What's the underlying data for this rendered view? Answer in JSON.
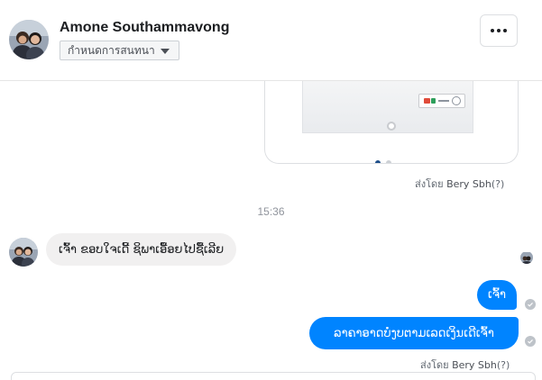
{
  "header": {
    "contact_name": "Amone Southammavong",
    "conversation_settings_label": "กำหนดการสนทนา",
    "more_icon": "more-horizontal-icon"
  },
  "card": {
    "image_desc_icon": "product-image",
    "carousel_pages": 2,
    "carousel_active": 1
  },
  "messages": [
    {
      "sent_by_prefix": "ส่งโดย",
      "sent_by_name": "Bery Sbh",
      "sent_by_suffix": "(?)"
    }
  ],
  "timestamp": "15:36",
  "incoming": {
    "text": "ເຈົ້າ ຂອບໃຈເດີ້ ຊິພາເອື້ອຍໄປຊື້ເລີຍ"
  },
  "outgoing": [
    {
      "text": "ເຈົ້າ"
    },
    {
      "text": "ລາຄາອາດບໍ່ງບຕາມເລດເງິນເດີເຈົ້າ"
    }
  ],
  "footer_sent_by": {
    "prefix": "ส่งโดย",
    "name": "Bery Sbh",
    "suffix": "(?)"
  },
  "colors": {
    "accent": "#0084ff",
    "incoming_bubble": "#f1f0f0"
  }
}
